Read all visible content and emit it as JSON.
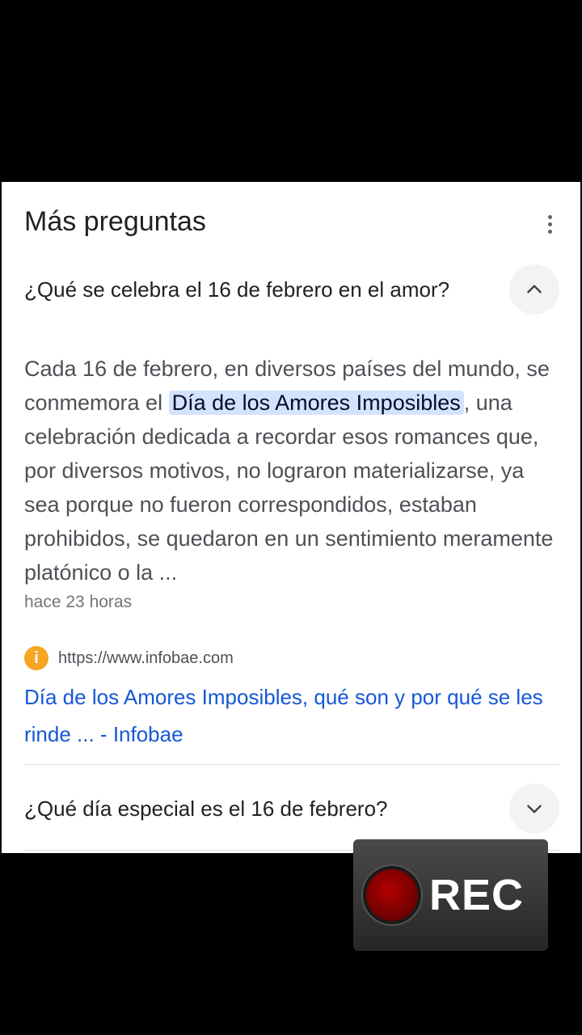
{
  "section": {
    "title": "Más preguntas"
  },
  "questions": [
    {
      "text": "¿Qué se celebra el 16 de febrero en el amor?",
      "expanded": true,
      "answer": {
        "before": "Cada 16 de febrero, en diversos países del mundo, se conmemora el ",
        "highlight": "Día de los Amores Imposibles",
        "after": ", una celebración dedicada a recordar esos romances que, por diversos motivos, no lograron materializarse, ya sea porque no fueron correspondidos, estaban prohibidos, se quedaron en un sentimiento meramente platónico o la ..."
      },
      "timestamp": "hace 23 horas",
      "source": {
        "favicon_letter": "i",
        "url": "https://www.infobae.com",
        "link_text": "Día de los Amores Imposibles, qué son y por qué se les rinde ... - Infobae"
      }
    },
    {
      "text": "¿Qué día especial es el 16 de febrero?",
      "expanded": false
    }
  ],
  "overlay": {
    "rec_label": "REC"
  },
  "colors": {
    "link": "#1558d6",
    "highlight_bg": "#d3e3fd",
    "rec_dot": "#8b0000"
  }
}
